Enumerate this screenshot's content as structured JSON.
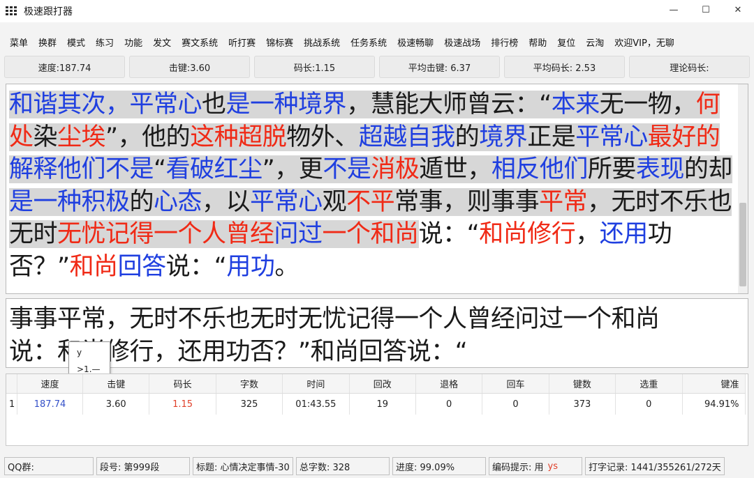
{
  "window": {
    "title": "极速跟打器",
    "minimize": "—",
    "maximize": "☐",
    "close": "✕"
  },
  "menu": [
    "菜单",
    "换群",
    "模式",
    "练习",
    "功能",
    "发文",
    "赛文系统",
    "听打赛",
    "锦标赛",
    "挑战系统",
    "任务系统",
    "极速畅聊",
    "极速战场",
    "排行榜",
    "帮助",
    "复位",
    "云淘",
    "欢迎VIP，无聊"
  ],
  "stats": [
    {
      "label": "速度:187.74"
    },
    {
      "label": "击键:3.60"
    },
    {
      "label": "码长:1.15"
    },
    {
      "label": "平均击键: 6.37"
    },
    {
      "label": "平均码长: 2.53"
    },
    {
      "label": "理论码长:"
    }
  ],
  "article": {
    "segments": [
      {
        "text": "和谐其次，",
        "color": "blue",
        "hl": true
      },
      {
        "text": "平常心",
        "color": "blue",
        "hl": true
      },
      {
        "text": "也",
        "color": "black",
        "hl": true
      },
      {
        "text": "是一种境界",
        "color": "blue",
        "hl": true
      },
      {
        "text": "，慧能大师曾云：“",
        "color": "black",
        "hl": true
      },
      {
        "text": "本来",
        "color": "blue",
        "hl": true
      },
      {
        "text": "无一物，",
        "color": "black",
        "hl": true
      },
      {
        "text": "何处",
        "color": "red",
        "hl": true
      },
      {
        "text": "染",
        "color": "black",
        "hl": true
      },
      {
        "text": "尘埃",
        "color": "red",
        "hl": true
      },
      {
        "text": "”，他的",
        "color": "black",
        "hl": true
      },
      {
        "text": "这种超脱",
        "color": "red",
        "hl": true
      },
      {
        "text": "物外、",
        "color": "black",
        "hl": true
      },
      {
        "text": "超越自我",
        "color": "blue",
        "hl": true
      },
      {
        "text": "的",
        "color": "black",
        "hl": true
      },
      {
        "text": "境界",
        "color": "blue",
        "hl": true
      },
      {
        "text": "正是",
        "color": "black",
        "hl": true
      },
      {
        "text": "平常心",
        "color": "blue",
        "hl": true
      },
      {
        "text": "最好的",
        "color": "red",
        "hl": true
      },
      {
        "text": "解释他们不是",
        "color": "blue",
        "hl": true
      },
      {
        "text": "“",
        "color": "black",
        "hl": true
      },
      {
        "text": "看破红尘",
        "color": "blue",
        "hl": true
      },
      {
        "text": "”，更",
        "color": "black",
        "hl": true
      },
      {
        "text": "不是",
        "color": "blue",
        "hl": true
      },
      {
        "text": "消极",
        "color": "red",
        "hl": true
      },
      {
        "text": "遁世，",
        "color": "black",
        "hl": true
      },
      {
        "text": "相反他们",
        "color": "blue",
        "hl": true
      },
      {
        "text": "所要",
        "color": "black",
        "hl": true
      },
      {
        "text": "表现",
        "color": "blue",
        "hl": true
      },
      {
        "text": "的却",
        "color": "black",
        "hl": true
      },
      {
        "text": "是一种积极",
        "color": "blue",
        "hl": true
      },
      {
        "text": "的",
        "color": "black",
        "hl": true
      },
      {
        "text": "心态",
        "color": "blue",
        "hl": true
      },
      {
        "text": "，以",
        "color": "black",
        "hl": true
      },
      {
        "text": "平常心",
        "color": "blue",
        "hl": true
      },
      {
        "text": "观",
        "color": "black",
        "hl": true
      },
      {
        "text": "不平",
        "color": "red",
        "hl": true
      },
      {
        "text": "常事，则事事",
        "color": "black",
        "hl": true
      },
      {
        "text": "平常",
        "color": "red",
        "hl": true
      },
      {
        "text": "，无时不乐也无时",
        "color": "black",
        "hl": true
      },
      {
        "text": "无忧记得一个人曾经",
        "color": "red",
        "hl": true
      },
      {
        "text": "问过",
        "color": "blue",
        "hl": true
      },
      {
        "text": "一个和尚",
        "color": "red",
        "hl": true
      },
      {
        "text": "说：“",
        "color": "black",
        "hl": false
      },
      {
        "text": "和尚修行",
        "color": "red",
        "hl": false
      },
      {
        "text": "，",
        "color": "black",
        "hl": false
      },
      {
        "text": "还用",
        "color": "blue",
        "hl": false
      },
      {
        "text": "功否？”",
        "color": "black",
        "hl": false
      },
      {
        "text": "和尚",
        "color": "red",
        "hl": false
      },
      {
        "text": "回答",
        "color": "blue",
        "hl": false
      },
      {
        "text": "说：“",
        "color": "black",
        "hl": false
      },
      {
        "text": "用功",
        "color": "blue",
        "hl": false
      },
      {
        "text": "。",
        "color": "black",
        "hl": false
      }
    ]
  },
  "input": {
    "line1": "事事平常，无时不乐也无时无忧记得一个人曾经问过一个和尚",
    "line2": "说：和尚修行，还用功否？”和尚回答说：“"
  },
  "ime": {
    "code": "y",
    "candidate": ">1.—"
  },
  "results": {
    "headers": [
      "速度",
      "击键",
      "码长",
      "字数",
      "时间",
      "回改",
      "退格",
      "回车",
      "键数",
      "选重",
      "键准"
    ],
    "rows": [
      {
        "index": "1",
        "speed": "187.74",
        "keystroke": "3.60",
        "codelen": "1.15",
        "chars": "325",
        "time": "01:43.55",
        "backspace_fix": "19",
        "backspace": "0",
        "enter": "0",
        "keys": "373",
        "reselect": "0",
        "accuracy": "94.91%"
      }
    ]
  },
  "statusbar": {
    "qq": "QQ群:",
    "segment": "段号: 第999段",
    "title": "标题: 心情决定事情-30",
    "total": "总字数: 328",
    "progress": "进度: 99.09%",
    "hint": "编码提示: 用",
    "hint_code": "ys",
    "record": "打字记录: 1441/355261/272天"
  },
  "colors": {
    "blue": "#1f3fe0",
    "red": "#f02a16",
    "black": "#1a1a1a",
    "highlight": "#d7d7d7"
  }
}
